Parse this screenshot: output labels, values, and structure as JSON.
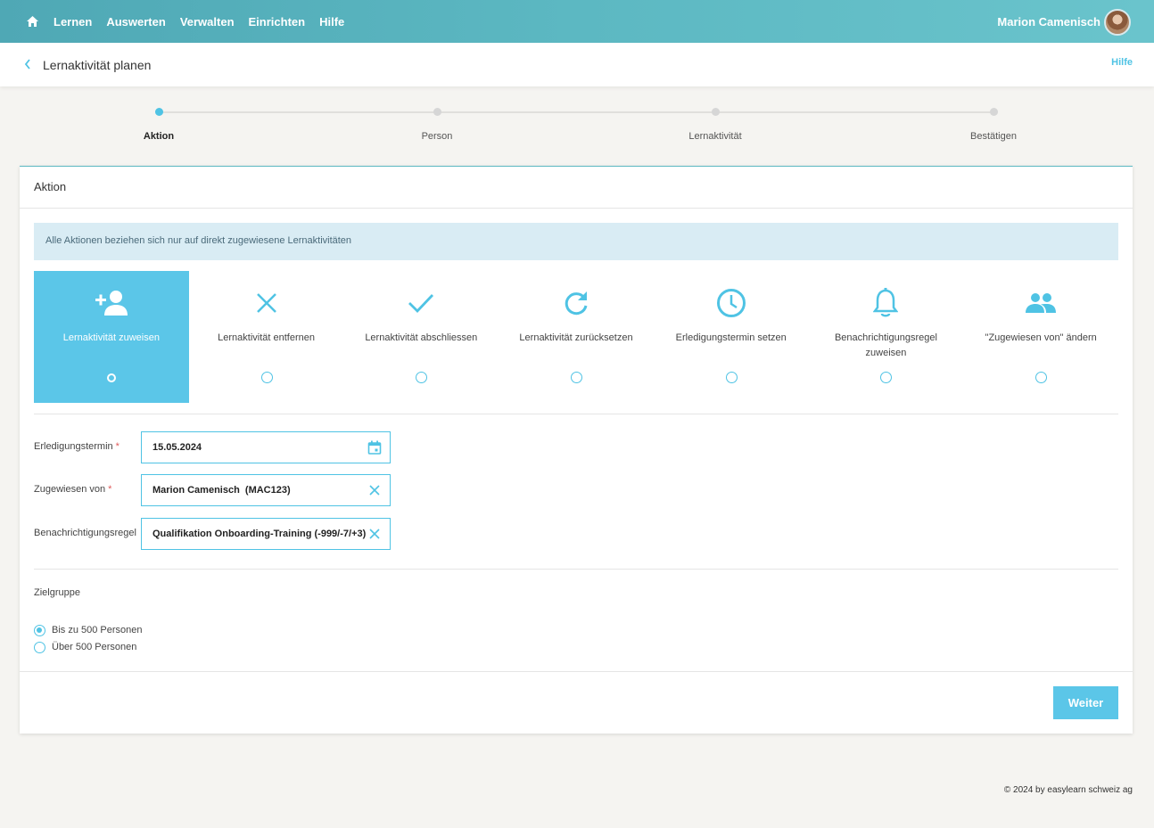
{
  "nav": {
    "items": [
      {
        "label": "Lernen"
      },
      {
        "label": "Auswerten"
      },
      {
        "label": "Verwalten"
      },
      {
        "label": "Einrichten"
      },
      {
        "label": "Hilfe"
      }
    ],
    "user_name": "Marion Camenisch"
  },
  "page": {
    "title": "Lernaktivität planen",
    "help": "Hilfe"
  },
  "stepper": {
    "steps": [
      {
        "label": "Aktion",
        "active": true
      },
      {
        "label": "Person",
        "active": false
      },
      {
        "label": "Lernaktivität",
        "active": false
      },
      {
        "label": "Bestätigen",
        "active": false
      }
    ]
  },
  "card": {
    "title": "Aktion",
    "info": "Alle Aktionen beziehen sich nur auf direkt zugewiesene Lernaktivitäten",
    "actions": [
      {
        "label": "Lernaktivität zuweisen",
        "icon": "add-person-icon",
        "selected": true
      },
      {
        "label": "Lernaktivität entfernen",
        "icon": "close-icon",
        "selected": false
      },
      {
        "label": "Lernaktivität abschliessen",
        "icon": "check-icon",
        "selected": false
      },
      {
        "label": "Lernaktivität zurücksetzen",
        "icon": "refresh-icon",
        "selected": false
      },
      {
        "label": "Erledigungstermin setzen",
        "icon": "clock-icon",
        "selected": false
      },
      {
        "label": "Benachrichtigungsregel zuweisen",
        "icon": "bell-icon",
        "selected": false
      },
      {
        "label": "\"Zugewiesen von\" ändern",
        "icon": "group-icon",
        "selected": false
      }
    ],
    "fields": {
      "due_date": {
        "label": "Erledigungstermin",
        "value": "15.05.2024",
        "required": true
      },
      "assigned_by": {
        "label": "Zugewiesen von",
        "value": "Marion Camenisch  (MAC123)",
        "required": true
      },
      "notification_rule": {
        "label": "Benachrichtigungsregel",
        "value": "Qualifikation Onboarding-Training (-999/-7/+3)",
        "required": false
      }
    },
    "target_group": {
      "label": "Zielgruppe",
      "options": [
        {
          "label": "Bis zu 500 Personen",
          "checked": true
        },
        {
          "label": "Über 500 Personen",
          "checked": false
        }
      ]
    },
    "next_button": "Weiter"
  },
  "footer": "© 2024 by easylearn schweiz ag",
  "colors": {
    "accent": "#5bc6e8",
    "nav": "#5cb8c2",
    "info_bg": "#d9ecf4"
  }
}
